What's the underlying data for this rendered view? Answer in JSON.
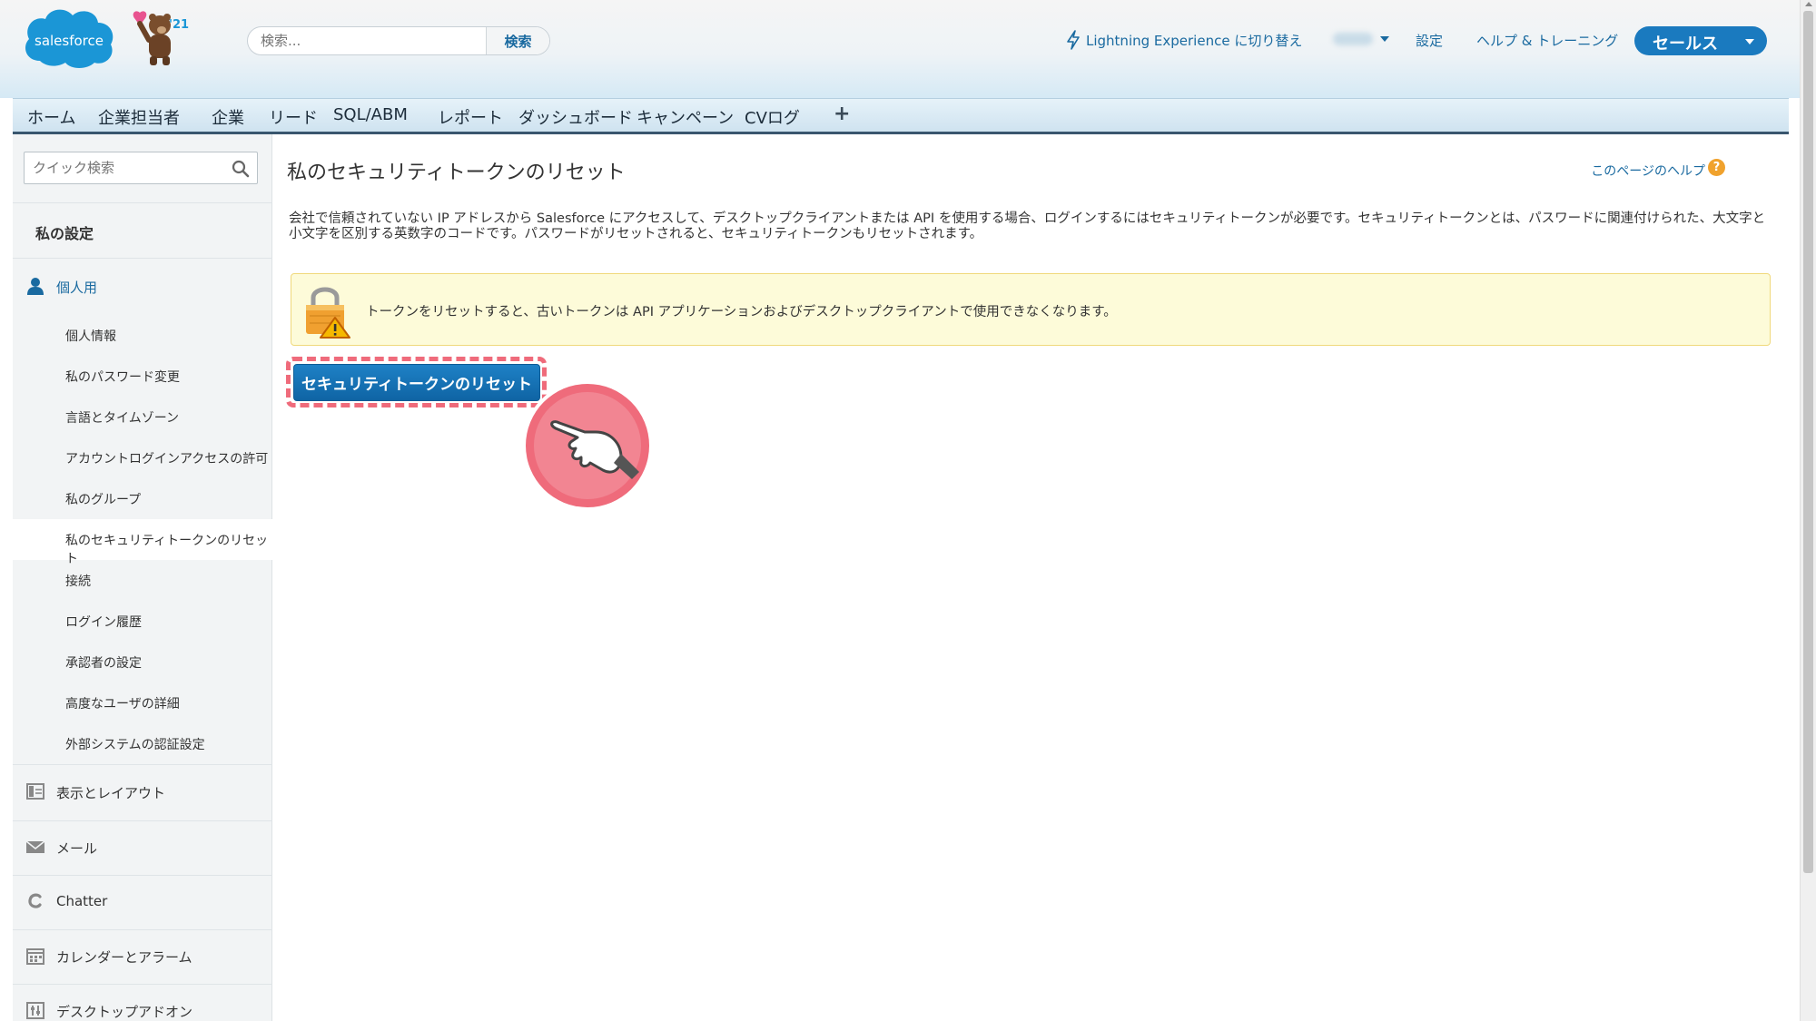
{
  "header": {
    "logo_text": "salesforce",
    "logo_year": "'21",
    "search_placeholder": "検索...",
    "search_button": "検索",
    "lightning_link": "Lightning Experience に切り替え",
    "settings_link": "設定",
    "help_link": "ヘルプ & トレーニング",
    "app_switcher": "セールス"
  },
  "tabs": [
    "ホーム",
    "企業担当者",
    "企業",
    "リード",
    "SQL/ABM",
    "レポート",
    "ダッシュボード",
    "キャンペーン",
    "CVログ"
  ],
  "sidebar": {
    "quick_search_placeholder": "クイック検索",
    "title": "私の設定",
    "sections": [
      {
        "label": "個人用",
        "icon": "person-icon",
        "active": true
      },
      {
        "label": "表示とレイアウト",
        "icon": "layout-icon"
      },
      {
        "label": "メール",
        "icon": "mail-icon"
      },
      {
        "label": "Chatter",
        "icon": "chatter-icon"
      },
      {
        "label": "カレンダーとアラーム",
        "icon": "calendar-icon"
      },
      {
        "label": "デスクトップアドオン",
        "icon": "desktop-addon-icon"
      }
    ],
    "personal_items": [
      "個人情報",
      "私のパスワード変更",
      "言語とタイムゾーン",
      "アカウントログインアクセスの許可",
      "私のグループ",
      "私のセキュリティトークンのリセット",
      "接続",
      "ログイン履歴",
      "承認者の設定",
      "高度なユーザの詳細",
      "外部システムの認証設定"
    ],
    "selected_item": "私のセキュリティトークンのリセット"
  },
  "main": {
    "title": "私のセキュリティトークンのリセット",
    "help_link": "このページのヘルプ",
    "description": "会社で信頼されていない IP アドレスから Salesforce にアクセスして、デスクトップクライアントまたは API を使用する場合、ログインするにはセキュリティトークンが必要です。セキュリティトークンとは、パスワードに関連付けられた、大文字と小文字を区別する英数字のコードです。パスワードがリセットされると、セキュリティトークンもリセットされます。",
    "warning": "トークンをリセットすると、古いトークンは API アプリケーションおよびデスクトップクライアントで使用できなくなります。",
    "reset_button": "セキュリティトークンのリセット"
  },
  "colors": {
    "accent": "#1a7abf",
    "highlight": "#ef6b7b",
    "warning_bg": "#fdfbd9"
  }
}
